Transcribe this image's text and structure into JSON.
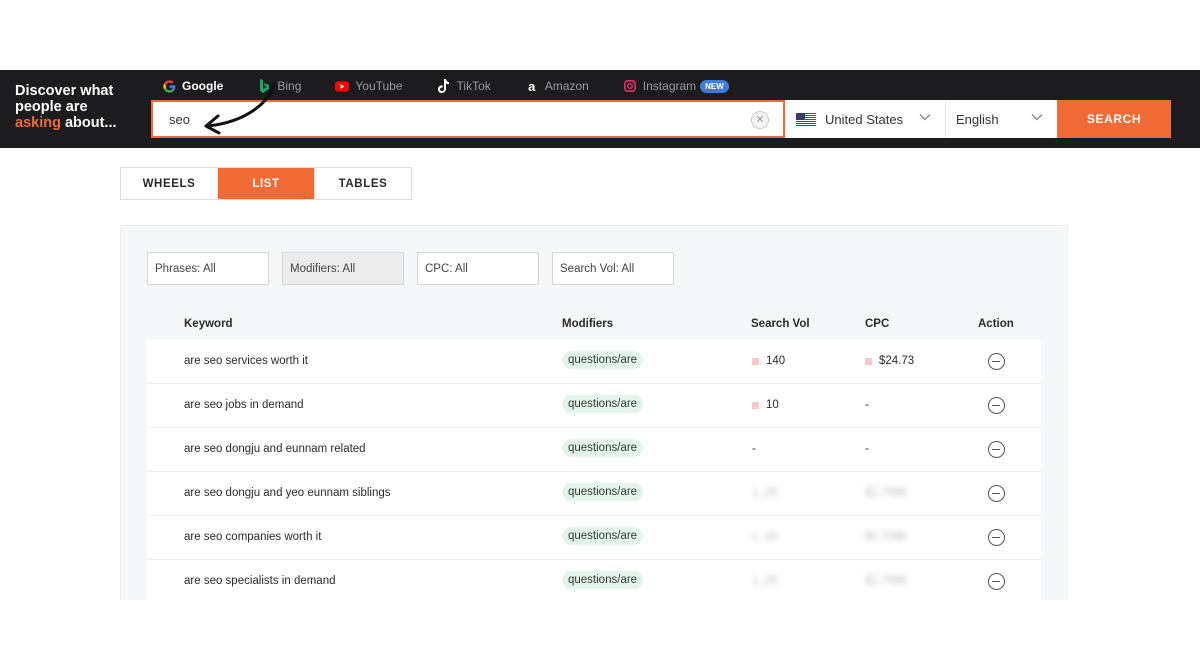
{
  "header": {
    "tagline_line1": "Discover what",
    "tagline_line2": "people are",
    "tagline_accent": "asking",
    "tagline_tail": " about...",
    "engines": [
      {
        "label": "Google",
        "icon": "google-icon"
      },
      {
        "label": "Bing",
        "icon": "bing-icon"
      },
      {
        "label": "YouTube",
        "icon": "youtube-icon"
      },
      {
        "label": "TikTok",
        "icon": "tiktok-icon"
      },
      {
        "label": "Amazon",
        "icon": "amazon-icon"
      },
      {
        "label": "Instagram",
        "icon": "instagram-icon",
        "badge": "NEW"
      }
    ],
    "search": {
      "value": "seo",
      "clear_icon": "clear-icon"
    },
    "country": {
      "value": "United States",
      "icon": "us-flag-icon"
    },
    "language": {
      "value": "English"
    },
    "search_button": "SEARCH"
  },
  "view_tabs": {
    "wheels": "WHEELS",
    "list": "LIST",
    "tables": "TABLES",
    "active": "LIST"
  },
  "filters": {
    "phrases": "Phrases: All",
    "modifiers": "Modifiers: All",
    "cpc": "CPC: All",
    "search_vol": "Search Vol: All"
  },
  "table": {
    "headers": {
      "keyword": "Keyword",
      "modifiers": "Modifiers",
      "search_vol": "Search Vol",
      "cpc": "CPC",
      "action": "Action"
    },
    "rows": [
      {
        "keyword": "are seo services worth it",
        "modifier": "questions/are",
        "search_vol": "140",
        "cpc": "$24.73"
      },
      {
        "keyword": "are seo jobs in demand",
        "modifier": "questions/are",
        "search_vol": "10",
        "cpc": "-"
      },
      {
        "keyword": "are seo dongju and eunnam related",
        "modifier": "questions/are",
        "search_vol": "-",
        "cpc": "-"
      },
      {
        "keyword": "are seo dongju and yeo eunnam siblings",
        "modifier": "questions/are",
        "search_vol": "",
        "cpc": ""
      },
      {
        "keyword": "are seo companies worth it",
        "modifier": "questions/are",
        "search_vol": "",
        "cpc": ""
      },
      {
        "keyword": "are seo specialists in demand",
        "modifier": "questions/are",
        "search_vol": "",
        "cpc": ""
      }
    ]
  },
  "colors": {
    "accent": "#f26a35",
    "header_bg": "#1c1c1f",
    "pill_bg": "#e3f5ea"
  }
}
